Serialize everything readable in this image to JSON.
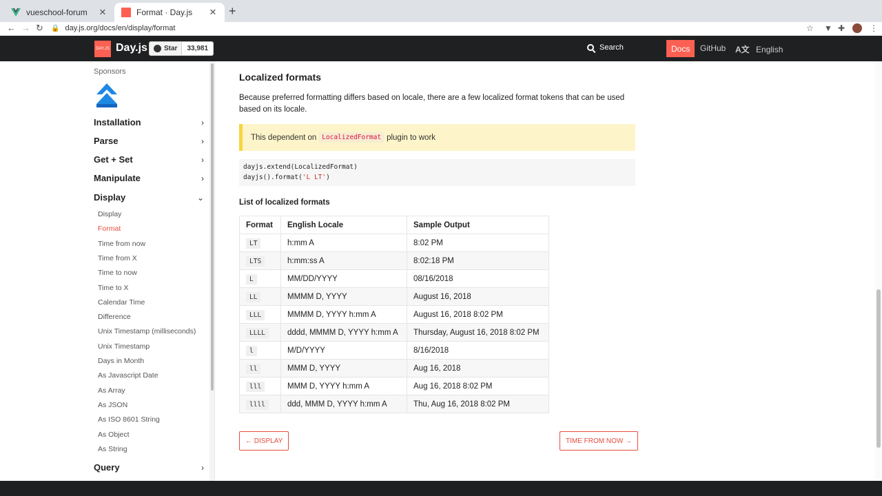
{
  "browser": {
    "tabs": [
      {
        "title": "vueschool-forum",
        "active": false
      },
      {
        "title": "Format · Day.js",
        "active": true
      }
    ],
    "url": "day.js.org/docs/en/display/format"
  },
  "header": {
    "logo_text": "DAY.JS",
    "brand": "Day.js",
    "star_label": "Star",
    "star_count": "33,981",
    "search_label": "Search",
    "nav": {
      "docs": "Docs",
      "github": "GitHub",
      "language": "English"
    }
  },
  "sidebar": {
    "sponsors_label": "Sponsors",
    "sections": [
      {
        "label": "Installation"
      },
      {
        "label": "Parse"
      },
      {
        "label": "Get + Set"
      },
      {
        "label": "Manipulate"
      },
      {
        "label": "Display"
      },
      {
        "label": "Query"
      }
    ],
    "display_items": [
      "Display",
      "Format",
      "Time from now",
      "Time from X",
      "Time to now",
      "Time to X",
      "Calendar Time",
      "Difference",
      "Unix Timestamp (milliseconds)",
      "Unix Timestamp",
      "Days in Month",
      "As Javascript Date",
      "As Array",
      "As JSON",
      "As ISO 8601 String",
      "As Object",
      "As String"
    ],
    "active_item": "Format"
  },
  "main": {
    "heading": "Localized formats",
    "intro": "Because preferred formatting differs based on locale, there are a few localized format tokens that can be used based on its locale.",
    "note_prefix": "This dependent on",
    "note_code": "LocalizedFormat",
    "note_suffix": "plugin to work",
    "code_line1": "dayjs.extend(LocalizedFormat)",
    "code_line2_a": "dayjs().format(",
    "code_line2_str": "'L LT'",
    "code_line2_b": ")",
    "list_heading": "List of localized formats",
    "table": {
      "headers": [
        "Format",
        "English Locale",
        "Sample Output"
      ],
      "rows": [
        [
          "LT",
          "h:mm A",
          "8:02 PM"
        ],
        [
          "LTS",
          "h:mm:ss A",
          "8:02:18 PM"
        ],
        [
          "L",
          "MM/DD/YYYY",
          "08/16/2018"
        ],
        [
          "LL",
          "MMMM D, YYYY",
          "August 16, 2018"
        ],
        [
          "LLL",
          "MMMM D, YYYY h:mm A",
          "August 16, 2018 8:02 PM"
        ],
        [
          "LLLL",
          "dddd, MMMM D, YYYY h:mm A",
          "Thursday, August 16, 2018 8:02 PM"
        ],
        [
          "l",
          "M/D/YYYY",
          "8/16/2018"
        ],
        [
          "ll",
          "MMM D, YYYY",
          "Aug 16, 2018"
        ],
        [
          "lll",
          "MMM D, YYYY h:mm A",
          "Aug 16, 2018 8:02 PM"
        ],
        [
          "llll",
          "ddd, MMM D, YYYY h:mm A",
          "Thu, Aug 16, 2018 8:02 PM"
        ]
      ]
    },
    "prev_button": "← DISPLAY",
    "next_button": "TIME FROM NOW →"
  },
  "colors": {
    "accent": "#fb6052",
    "header_bg": "#1f2022",
    "note_bg": "#fdf5c9",
    "note_border": "#f5d53f"
  }
}
